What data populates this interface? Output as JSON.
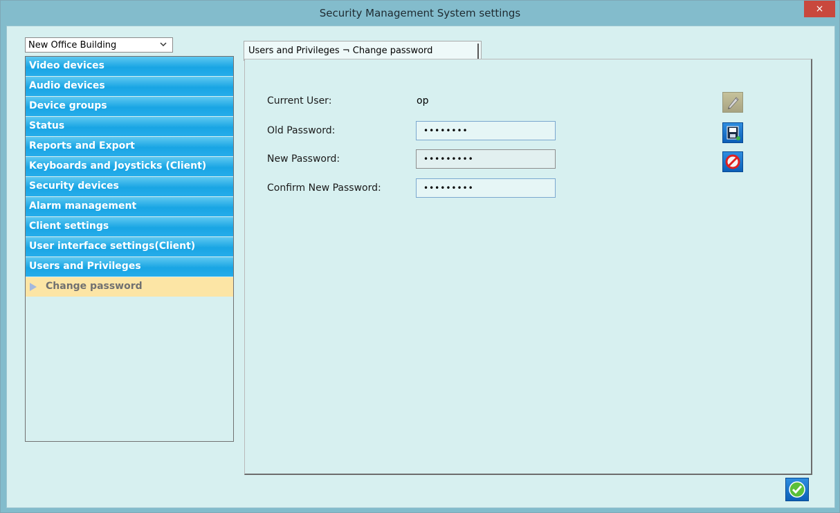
{
  "window": {
    "title": "Security Management System settings",
    "close_label": "×"
  },
  "building_select": {
    "value": "New Office Building"
  },
  "nav": {
    "items": [
      {
        "label": "Video devices"
      },
      {
        "label": "Audio devices"
      },
      {
        "label": "Device groups"
      },
      {
        "label": "Status"
      },
      {
        "label": "Reports and Export"
      },
      {
        "label": "Keyboards and Joysticks (Client)"
      },
      {
        "label": "Security devices"
      },
      {
        "label": "Alarm management"
      },
      {
        "label": "Client settings"
      },
      {
        "label": "User interface settings(Client)"
      },
      {
        "label": "Users and Privileges"
      }
    ],
    "selected_subitem": "Change password"
  },
  "tab": {
    "label": "Users and Privileges ¬ Change password"
  },
  "form": {
    "current_user_label": "Current User:",
    "current_user_value": "op",
    "old_password_label": "Old Password:",
    "old_password_value": "••••••••",
    "new_password_label": "New Password:",
    "new_password_value": "•••••••••",
    "confirm_password_label": "Confirm New Password:",
    "confirm_password_value": "•••••••••"
  },
  "icons": {
    "edit": "pencil-icon",
    "save": "floppy-disk-icon",
    "cancel": "prohibited-icon",
    "ok": "checkmark-icon"
  },
  "colors": {
    "title_bar": "#83bccc",
    "nav_item": "#19a5e4",
    "nav_selected": "#fce5a5",
    "content_bg": "#d7f0f0"
  }
}
